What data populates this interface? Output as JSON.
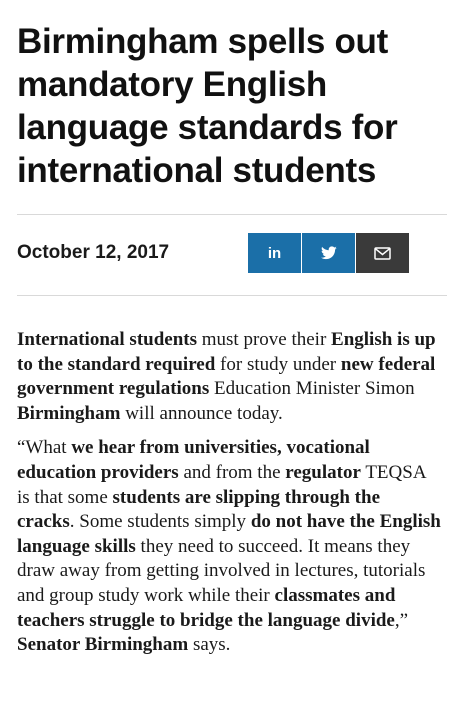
{
  "article": {
    "headline": "Birmingham spells out mandatory English language standards for international students",
    "date": "October 12, 2017"
  },
  "share": {
    "linkedin_label": "in",
    "icons": [
      "linkedin-icon",
      "twitter-icon",
      "email-icon"
    ],
    "linkedin_color": "#1b6fa8",
    "twitter_color": "#1b6fa8",
    "email_color": "#3a3a3a"
  },
  "paragraphs": [
    [
      {
        "t": "International students",
        "b": true
      },
      {
        "t": " must prove their ",
        "b": false
      },
      {
        "t": "English is up to the standard required",
        "b": true
      },
      {
        "t": " for study under ",
        "b": false
      },
      {
        "t": "new federal government regulations",
        "b": true
      },
      {
        "t": " Education Minister Simon ",
        "b": false
      },
      {
        "t": "Birmingham",
        "b": true
      },
      {
        "t": " will announce today.",
        "b": false
      }
    ],
    [
      {
        "t": "“What ",
        "b": false
      },
      {
        "t": "we hear from universities, vocational education providers",
        "b": true
      },
      {
        "t": " and from the ",
        "b": false
      },
      {
        "t": "regulator",
        "b": true
      },
      {
        "t": " TEQSA is that some ",
        "b": false
      },
      {
        "t": "students are slipping through the cracks",
        "b": true
      },
      {
        "t": ". Some students simply ",
        "b": false
      },
      {
        "t": "do not have the English language skills",
        "b": true
      },
      {
        "t": " they need to succeed. It means they draw away from getting involved in lectures, tutorials and group study work while their ",
        "b": false
      },
      {
        "t": "classmates and teachers struggle to bridge the language divide",
        "b": true
      },
      {
        "t": ",” ",
        "b": false
      },
      {
        "t": "Senator Birmingham",
        "b": true
      },
      {
        "t": " says.",
        "b": false
      }
    ]
  ]
}
